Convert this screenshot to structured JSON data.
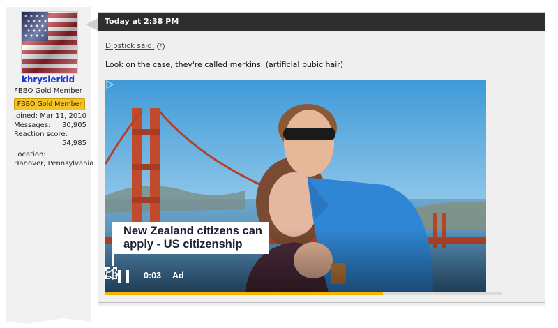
{
  "user": {
    "username": "khryslerkid",
    "title": "FBBO Gold Member",
    "badge": "FBBO Gold Member",
    "stats": {
      "joined_label": "Joined:",
      "joined_value": "Mar 11, 2010",
      "messages_label": "Messages:",
      "messages_value": "30,905",
      "reaction_label": "Reaction score:",
      "reaction_value": "54,985",
      "location_label": "Location:",
      "location_value": "Hanover, Pennsylvania"
    }
  },
  "post": {
    "timestamp": "Today at 2:38 PM",
    "quote_author": "Dipstick said:",
    "message": "Look on the case, they're called merkins. (artificial pubic hair)"
  },
  "video_ad": {
    "headline": "New Zealand citizens can apply - US citizenship",
    "time": "0:03",
    "ad_label": "Ad",
    "progress_fraction": 0.7
  },
  "colors": {
    "username": "#1d33d8",
    "badge": "#f5c325",
    "header": "#2e2e2e",
    "progress": "#f5b400"
  },
  "icons": [
    "us-flag-avatar",
    "quote-arrow-icon",
    "ad-choices-icon",
    "pause-icon",
    "mute-icon",
    "fullscreen-icon"
  ]
}
